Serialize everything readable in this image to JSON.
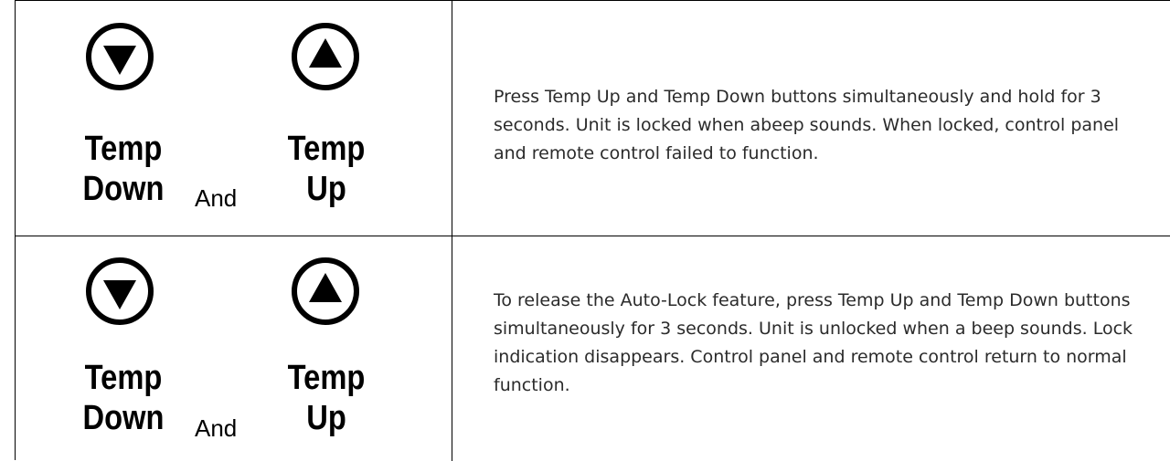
{
  "rows": [
    {
      "down_label_line1": "Temp",
      "down_label_line2": "Down",
      "and_label": "And",
      "up_label_line1": "Temp",
      "up_label_line2": "Up",
      "description": "Press Temp Up and Temp Down buttons simultaneously and hold for 3 seconds. Unit is locked when abeep sounds. When locked, control panel and remote control failed to function."
    },
    {
      "down_label_line1": "Temp",
      "down_label_line2": "Down",
      "and_label": "And",
      "up_label_line1": "Temp",
      "up_label_line2": "Up",
      "description": "To release the Auto-Lock feature, press Temp Up and Temp Down buttons simultaneously for 3 seconds. Unit is unlocked when a beep sounds. Lock indication disappears. Control panel and remote control return to normal function."
    }
  ],
  "icons": {
    "down": "triangle-down-circle-icon",
    "up": "triangle-up-circle-icon"
  }
}
